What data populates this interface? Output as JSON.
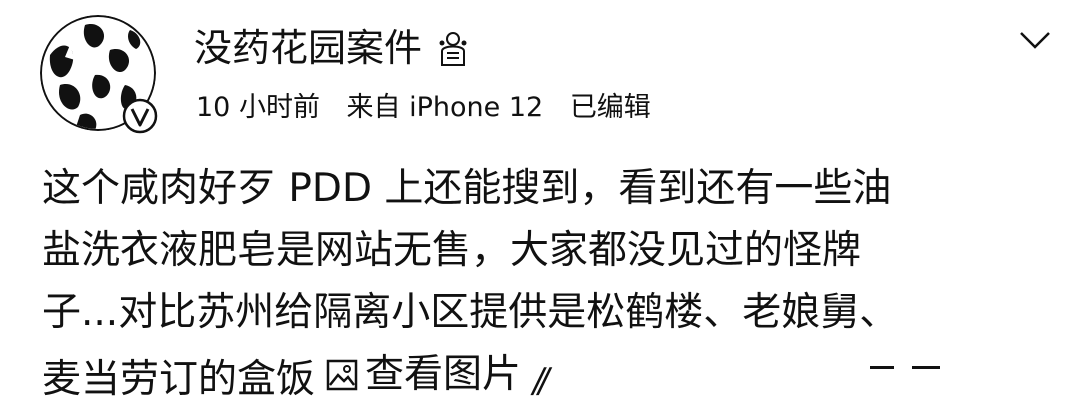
{
  "post": {
    "author": {
      "name": "没药花园案件",
      "verified": true
    },
    "meta": {
      "time": "10 小时前",
      "source": "来自 iPhone 12",
      "edited": "已编辑"
    },
    "content_lines": [
      "这个咸肉好歹 PDD 上还能搜到，看到还有一些油",
      "盐洗衣液肥皂是网站无售，大家都没见过的怪牌",
      "子...对比苏州给隔离小区提供是松鹤楼、老娘舅、",
      "麦当劳订的盒饭"
    ],
    "view_image_label": "查看图片",
    "icons": {
      "rank": "rank-medal-icon",
      "verified": "verified-badge-icon",
      "menu": "chevron-down-icon",
      "image": "image-icon"
    }
  }
}
